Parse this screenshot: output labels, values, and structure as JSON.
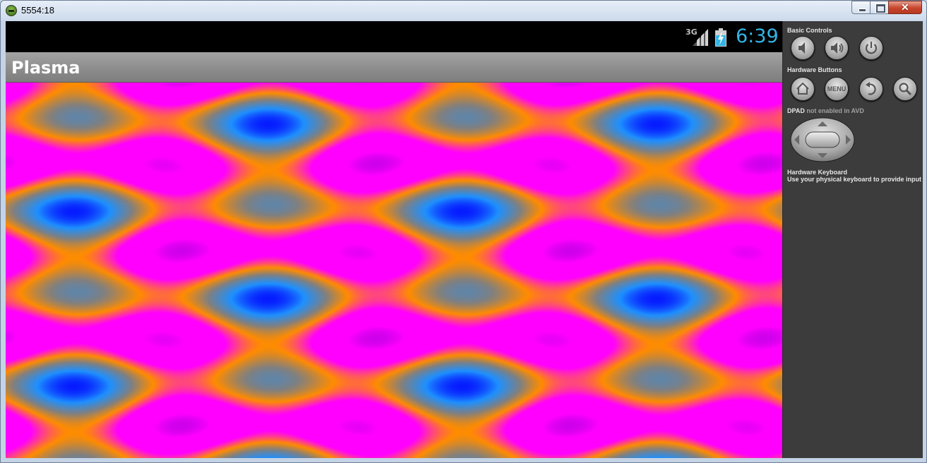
{
  "window": {
    "title": "5554:18"
  },
  "statusbar": {
    "network": "3G",
    "time": "6:39",
    "clock_color": "#33b5e5"
  },
  "app": {
    "name": "Plasma"
  },
  "controls": {
    "basic_controls": "Basic Controls",
    "hardware_buttons": "Hardware Buttons",
    "menu_label": "MENU",
    "dpad_title": "DPAD",
    "dpad_note": "not enabled in AVD",
    "keyboard_title": "Hardware Keyboard",
    "keyboard_note": "Use your physical keyboard to provide input"
  },
  "icons": [
    "app-icon",
    "minimize-icon",
    "maximize-icon",
    "close-icon",
    "signal-icon",
    "battery-charging-icon",
    "volume-down-icon",
    "volume-up-icon",
    "power-icon",
    "home-icon",
    "back-icon",
    "search-icon",
    "dpad-icon"
  ],
  "colors": {
    "plasma_palette": [
      "#0000ff",
      "#1e90ff",
      "#808080",
      "#ff8c00",
      "#ff00ff",
      "#9400d3"
    ]
  }
}
